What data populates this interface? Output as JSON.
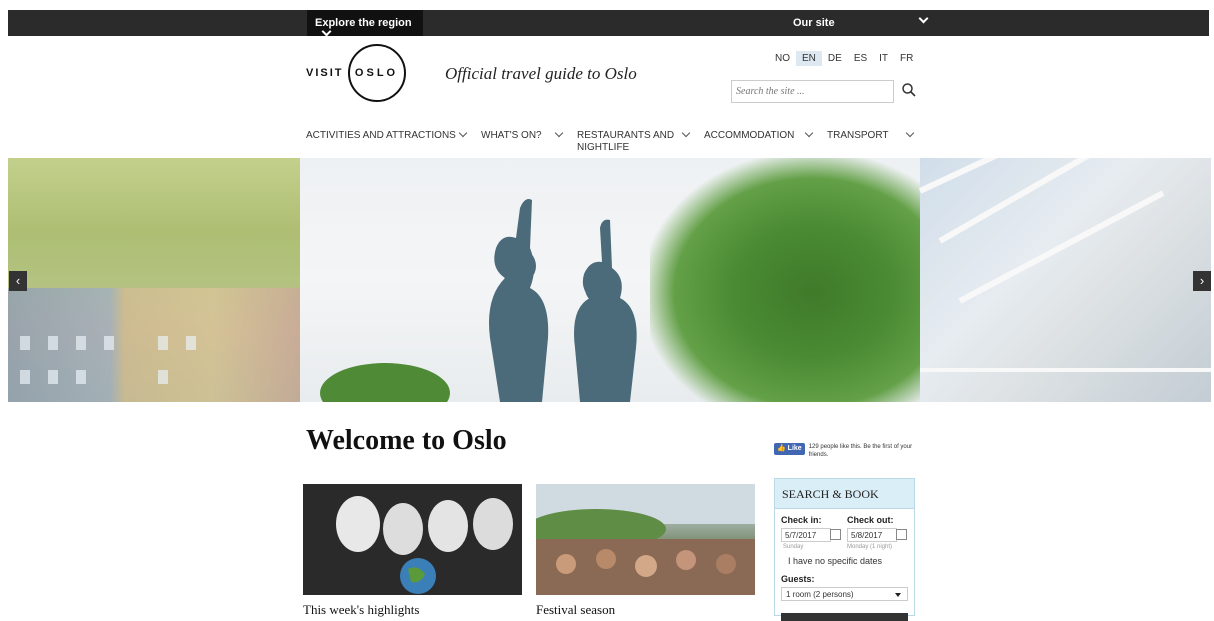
{
  "topbar": {
    "explore": "Explore the region",
    "our_site": "Our site"
  },
  "logo": {
    "visit": "VISIT",
    "oslo": "OSLO"
  },
  "tagline": "Official travel guide to Oslo",
  "languages": [
    "NO",
    "EN",
    "DE",
    "ES",
    "IT",
    "FR"
  ],
  "active_language": "EN",
  "search": {
    "placeholder": "Search the site ..."
  },
  "nav": {
    "activities": "ACTIVITIES AND ATTRACTIONS",
    "whats_on": "WHAT'S ON?",
    "restaurants_1": "RESTAURANTS AND",
    "restaurants_2": "NIGHTLIFE",
    "accommodation": "ACCOMMODATION",
    "transport": "TRANSPORT"
  },
  "carousel": {
    "prev": "‹",
    "next": "›"
  },
  "welcome": "Welcome to Oslo",
  "cards": [
    {
      "title": "This week's highlights"
    },
    {
      "title": "Festival season"
    }
  ],
  "facebook": {
    "like": "Like",
    "text": "129 people like this. Be the first of your friends."
  },
  "booking": {
    "title": "SEARCH & BOOK",
    "checkin_label": "Check in:",
    "checkout_label": "Check out:",
    "checkin_date": "5/7/2017",
    "checkout_date": "5/8/2017",
    "checkin_day": "Sunday",
    "checkout_day": "Monday (1 night)",
    "no_dates": "I have no specific dates",
    "guests_label": "Guests:",
    "guests_value": "1 room (2 persons)"
  }
}
